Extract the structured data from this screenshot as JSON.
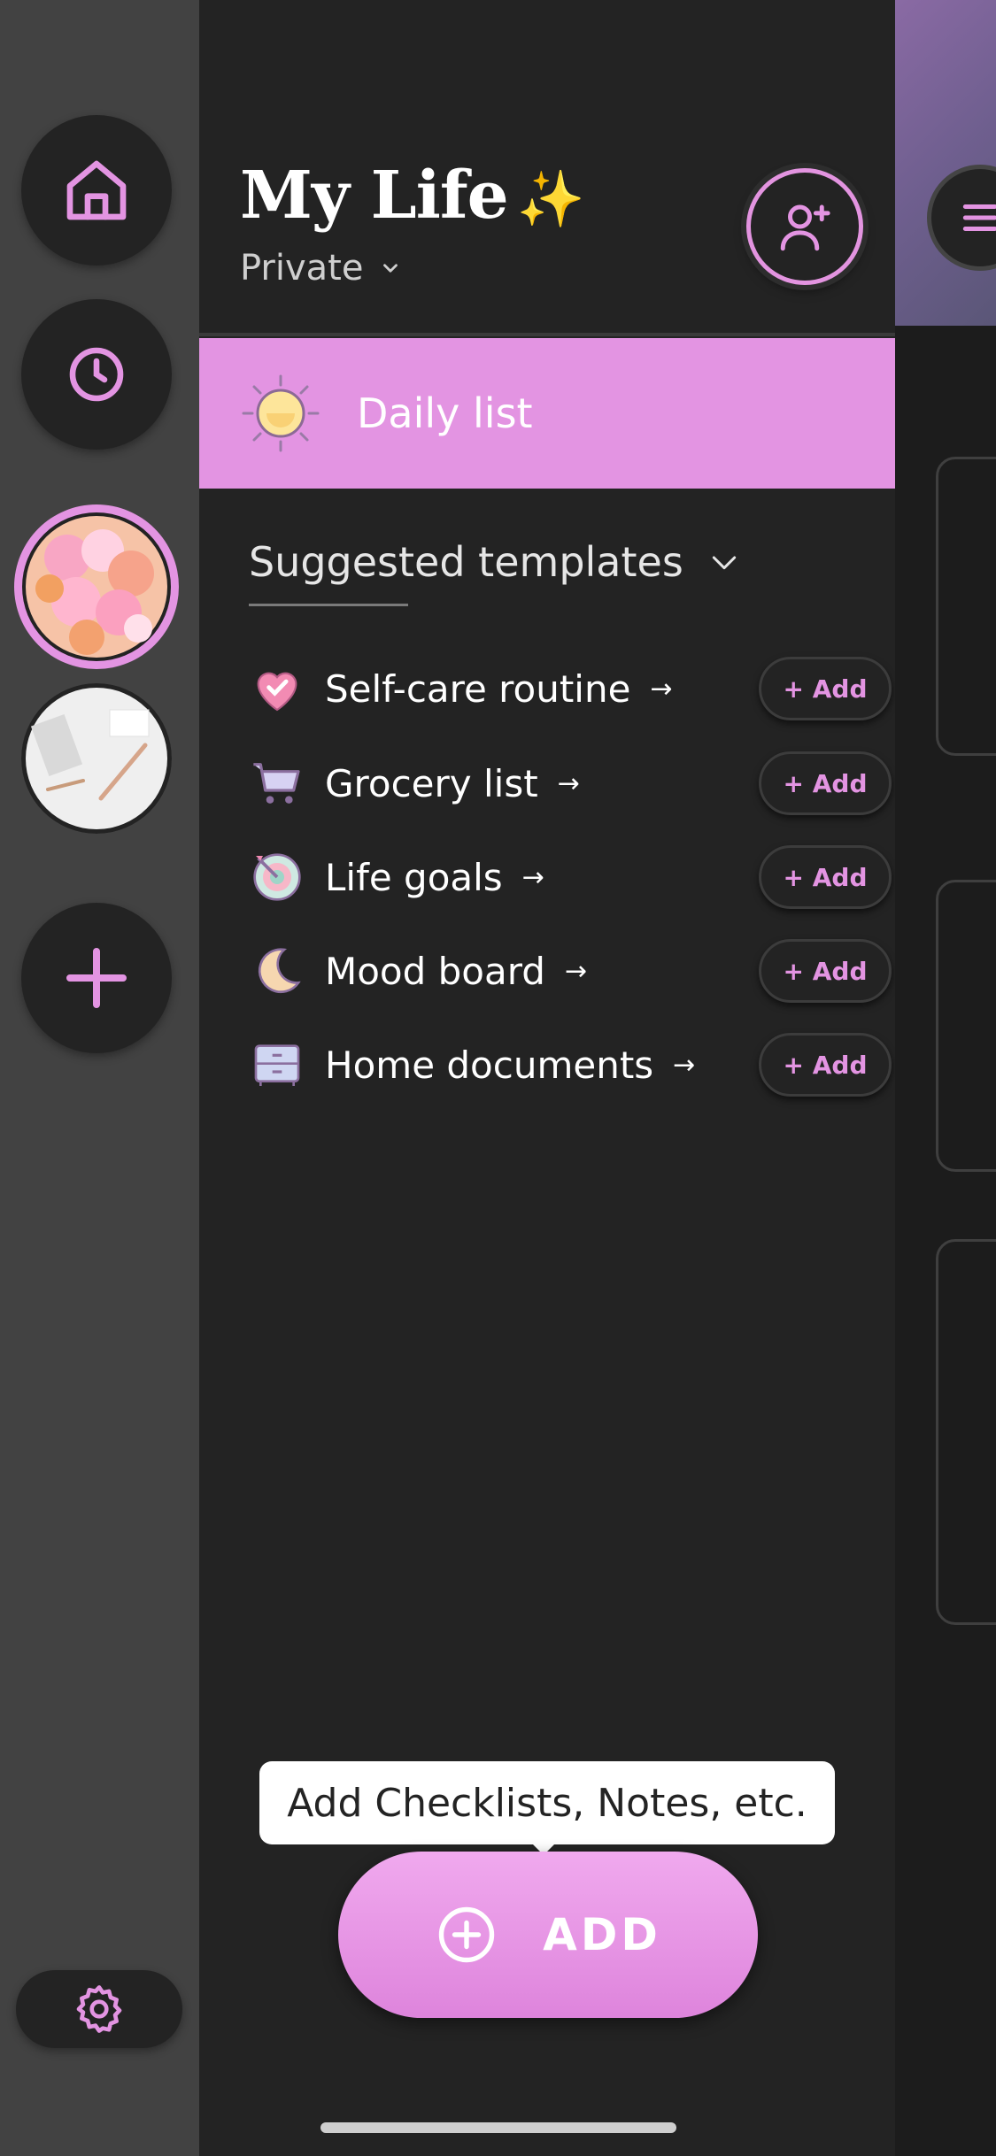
{
  "sidebar": {
    "items": [
      {
        "name": "home",
        "icon": "home-icon"
      },
      {
        "name": "history",
        "icon": "clock-icon"
      },
      {
        "name": "workspace-balloons",
        "icon": "balloons-thumbnail"
      },
      {
        "name": "workspace-desk",
        "icon": "desk-thumbnail"
      },
      {
        "name": "add-workspace",
        "icon": "plus-icon"
      }
    ],
    "settings_icon": "gear-icon"
  },
  "header": {
    "title": "My Life",
    "title_emoji": "✨",
    "privacy": "Private",
    "invite_icon": "add-user-icon"
  },
  "daily_list": {
    "label": "Daily list",
    "icon": "sun-icon"
  },
  "suggested": {
    "heading": "Suggested templates",
    "items": [
      {
        "name": "Self-care routine",
        "icon": "heart-check-icon",
        "action": "+ Add"
      },
      {
        "name": "Grocery list",
        "icon": "shopping-cart-icon",
        "action": "+ Add"
      },
      {
        "name": "Life goals",
        "icon": "target-icon",
        "action": "+ Add"
      },
      {
        "name": "Mood board",
        "icon": "moon-icon",
        "action": "+ Add"
      },
      {
        "name": "Home documents",
        "icon": "cabinet-icon",
        "action": "+ Add"
      }
    ]
  },
  "fab": {
    "tooltip": "Add Checklists, Notes, etc.",
    "label": "ADD"
  },
  "colors": {
    "accent": "#e394e2",
    "background": "#232323",
    "rail": "#424242"
  }
}
